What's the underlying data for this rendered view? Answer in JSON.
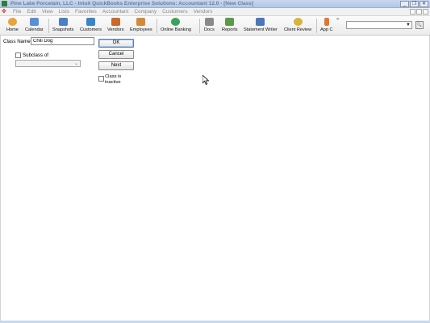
{
  "window": {
    "title": "Pine Lake Porcelain, LLC  - Intuit QuickBooks Enterprise Solutions: Accountant 12.0 - [New Class]",
    "controls": [
      "_",
      "❐",
      "✕"
    ]
  },
  "menu": {
    "items": [
      "File",
      "Edit",
      "View",
      "Lists",
      "Favorites",
      "Accountant",
      "Company",
      "Customers",
      "Vendors"
    ]
  },
  "toolbar": {
    "buttons": [
      {
        "label": "Home",
        "icon": "home-icon",
        "color": "#e8a33b"
      },
      {
        "label": "Calendar",
        "icon": "calendar-icon",
        "color": "#5a8fd6"
      },
      {
        "label": "Snapshots",
        "icon": "snapshots-icon",
        "color": "#4a7fc4"
      },
      {
        "label": "Customers",
        "icon": "customers-icon",
        "color": "#3b84c8"
      },
      {
        "label": "Vendors",
        "icon": "vendors-icon",
        "color": "#c86a2b"
      },
      {
        "label": "Employees",
        "icon": "employees-icon",
        "color": "#d08a3a"
      },
      {
        "label": "Online Banking",
        "icon": "online-banking-icon",
        "color": "#3aa35a"
      },
      {
        "label": "Docs",
        "icon": "docs-icon",
        "color": "#8a8a8a"
      },
      {
        "label": "Reports",
        "icon": "reports-icon",
        "color": "#5a9a4a"
      },
      {
        "label": "Statement Writer",
        "icon": "statement-writer-icon",
        "color": "#4b77b8"
      },
      {
        "label": "Client Review",
        "icon": "client-review-icon",
        "color": "#d8b43a"
      },
      {
        "label": "App C",
        "icon": "app-center-icon",
        "color": "#e07a2a"
      }
    ],
    "more": "»",
    "search_value": "",
    "search_arrow": "▼",
    "search_button": "🔍"
  },
  "form": {
    "class_name_label": "Class Name",
    "class_name_value": "Chili Dog",
    "subclass_label": "Subclass of",
    "subclass_value": "",
    "subclass_arrow": "⌄",
    "ok_label": "OK",
    "cancel_label": "Cancel",
    "next_label": "Next",
    "inactive_label": "Class is inactive"
  }
}
